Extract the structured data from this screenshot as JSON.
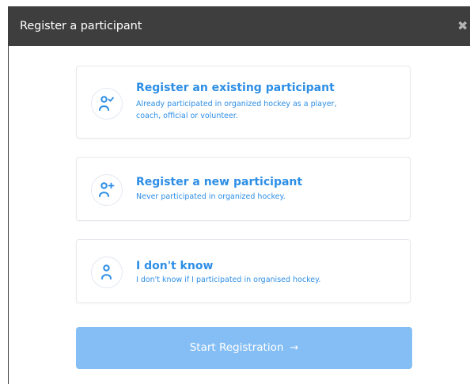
{
  "header": {
    "title": "Register a participant",
    "close_icon": "close-icon"
  },
  "options": [
    {
      "title": "Register an existing participant",
      "description_line1": "Already participated in organized hockey as a player,",
      "description_line2": "coach, official or volunteer.",
      "icon": "user-check-icon"
    },
    {
      "title": "Register a new participant",
      "description_line1": "Never participated in organized hockey.",
      "icon": "user-plus-icon"
    },
    {
      "title": "I don't know",
      "description_line1": "I don't know if I participated in organised hockey.",
      "icon": "user-icon"
    }
  ],
  "start_button": {
    "label": "Start Registration",
    "arrow": "→",
    "disabled": true
  },
  "colors": {
    "header_bg": "#3e3e3e",
    "accent": "#2d8ee6",
    "button_bg_disabled": "#85bef5"
  }
}
